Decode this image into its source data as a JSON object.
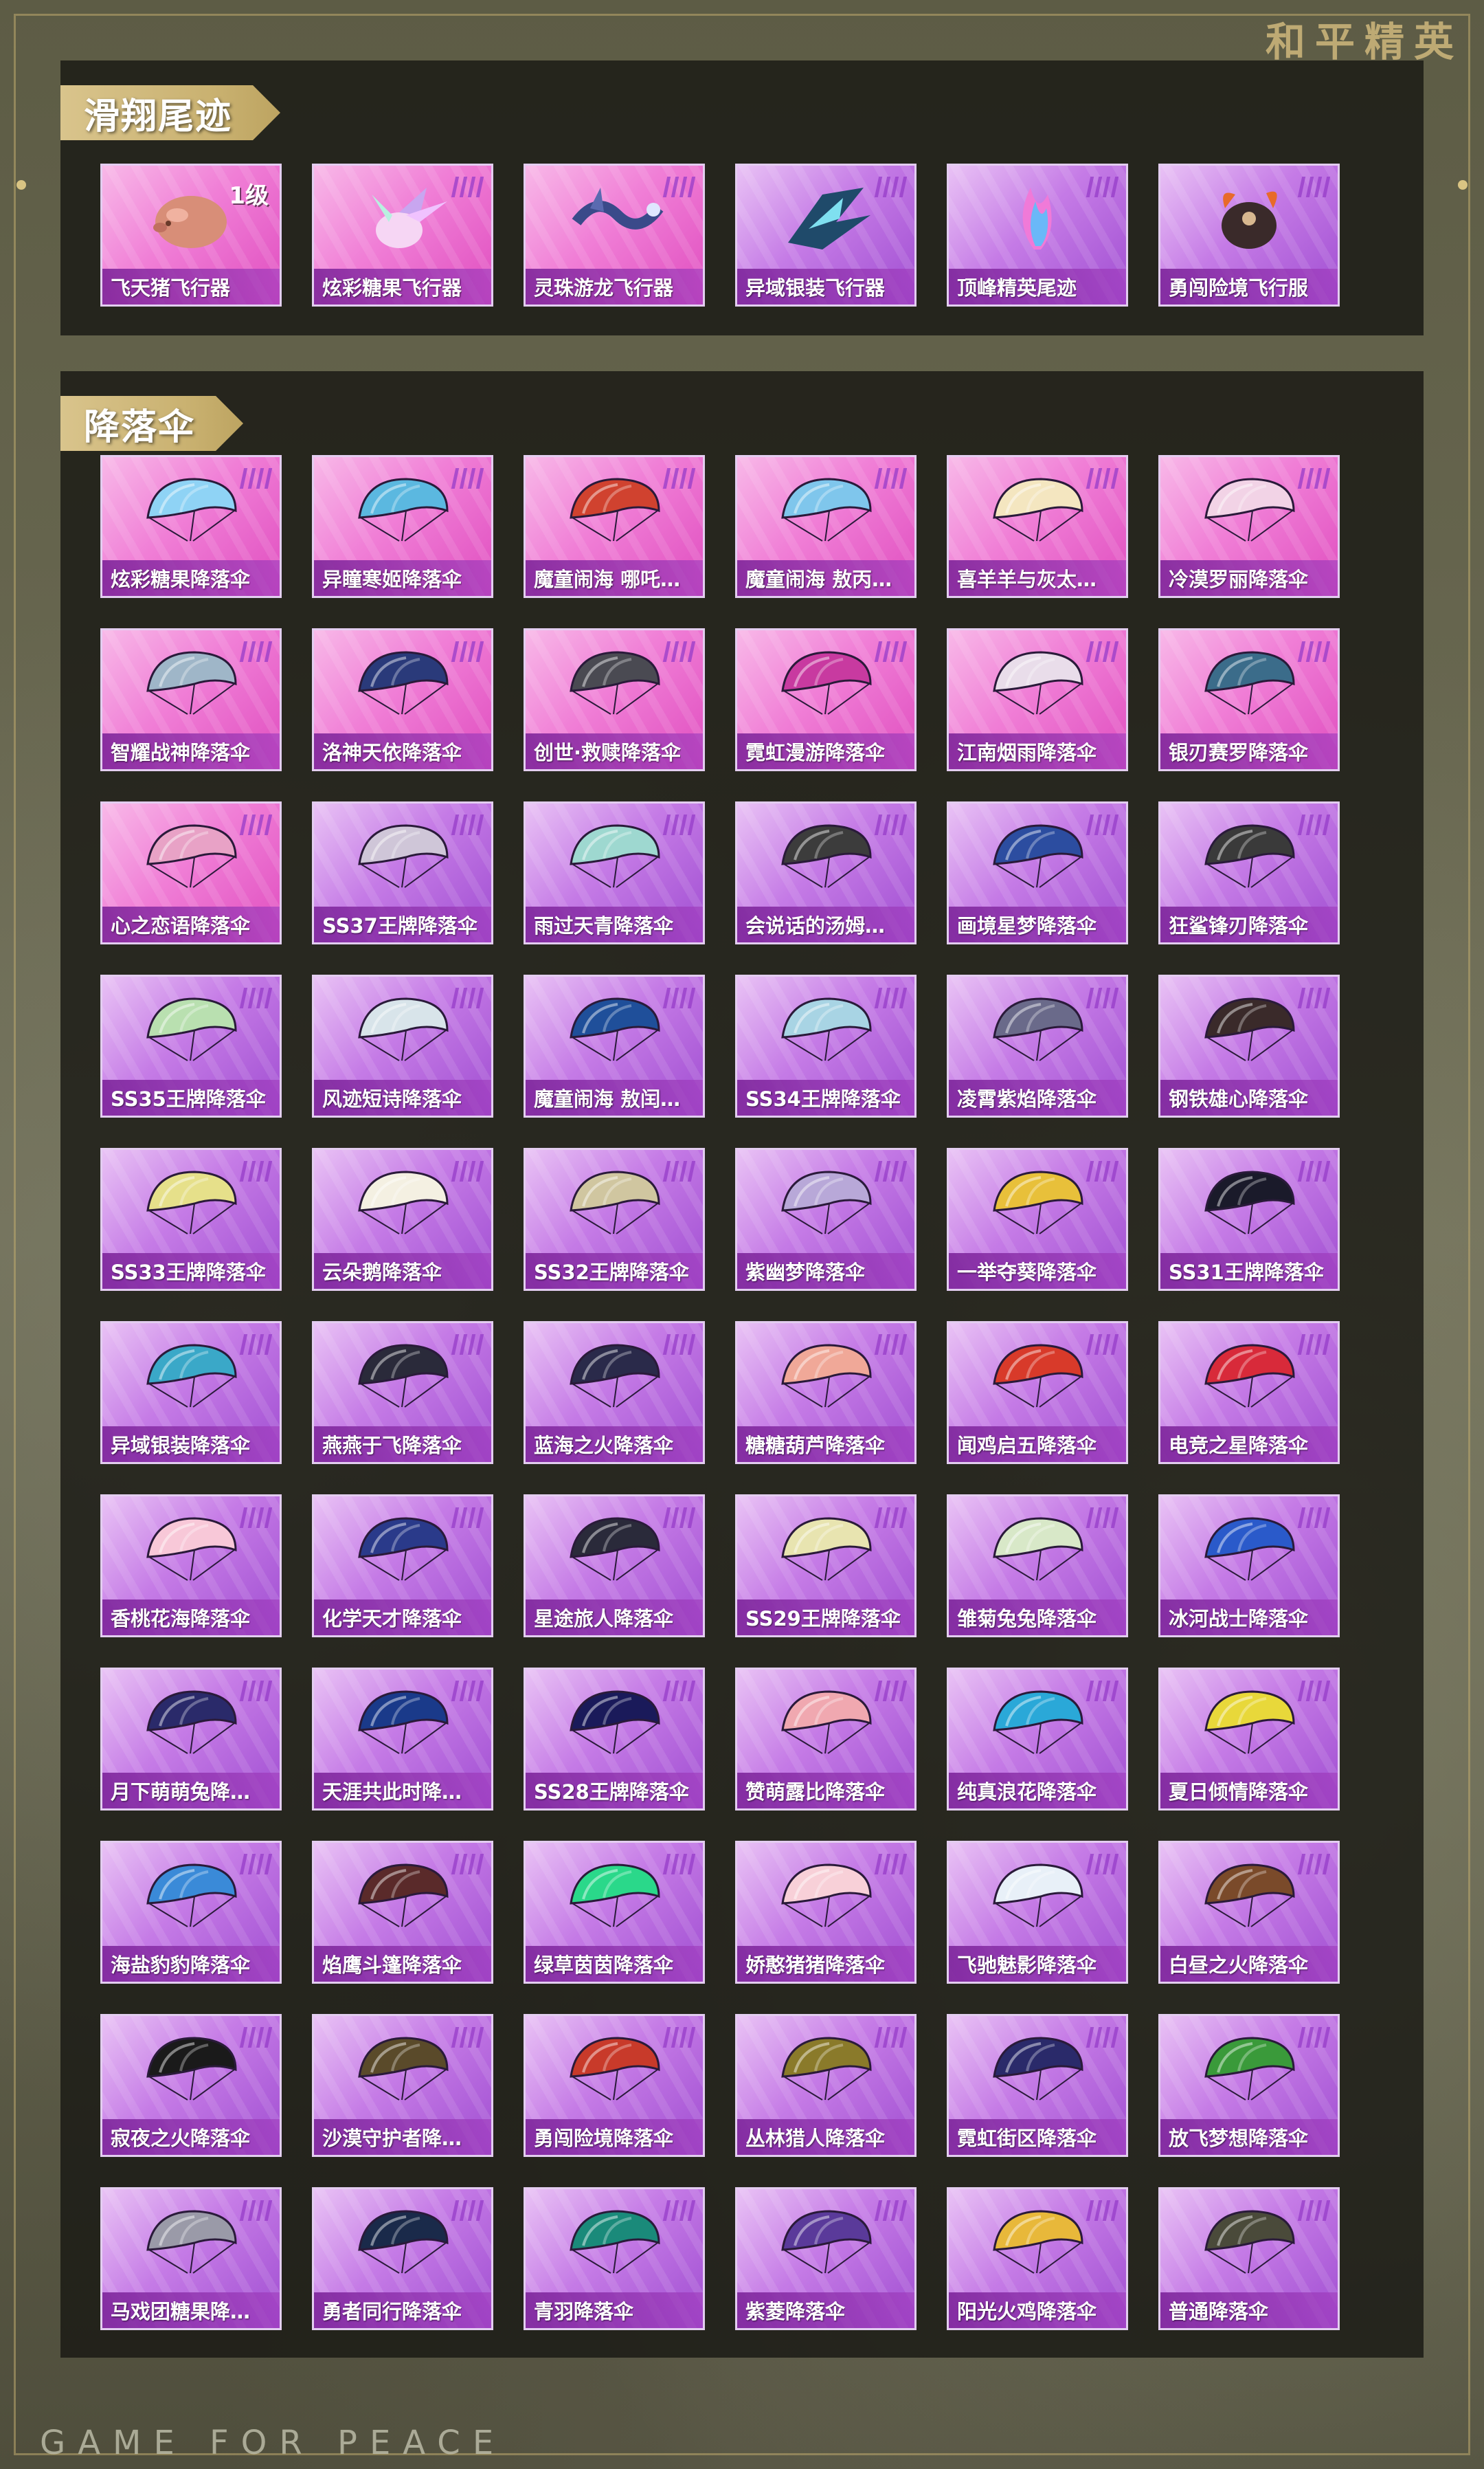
{
  "brand": {
    "top_logo": "和平精英",
    "bottom_text": "GAME FOR PEACE"
  },
  "trails": {
    "title": "滑翔尾迹",
    "items": [
      {
        "name": "飞天猪飞行器",
        "level": "1级",
        "style": "pink",
        "icon": "pig-icon"
      },
      {
        "name": "炫彩糖果飞行器",
        "style": "pink",
        "icon": "candy-craft-icon"
      },
      {
        "name": "灵珠游龙飞行器",
        "style": "pink",
        "icon": "dragon-icon"
      },
      {
        "name": "异域银装飞行器",
        "style": "purple",
        "icon": "winged-craft-icon"
      },
      {
        "name": "顶峰精英尾迹",
        "style": "purple",
        "icon": "flame-trail-icon"
      },
      {
        "name": "勇闯险境飞行服",
        "style": "purple",
        "icon": "flight-suit-icon"
      }
    ]
  },
  "chutes": {
    "title": "降落伞",
    "items": [
      {
        "name": "炫彩糖果降落伞",
        "style": "pink",
        "color": "#8fd3f5"
      },
      {
        "name": "异瞳寒姬降落伞",
        "style": "pink",
        "color": "#5bb8e0"
      },
      {
        "name": "魔童闹海 哪吒…",
        "style": "pink",
        "color": "#d0422f"
      },
      {
        "name": "魔童闹海 敖丙…",
        "style": "pink",
        "color": "#7fc6ec"
      },
      {
        "name": "喜羊羊与灰太…",
        "style": "pink",
        "color": "#f4e6c0"
      },
      {
        "name": "冷漠罗丽降落伞",
        "style": "pink",
        "color": "#f2d3e6"
      },
      {
        "name": "智耀战神降落伞",
        "style": "pink",
        "color": "#9fb6c8"
      },
      {
        "name": "洛神天依降落伞",
        "style": "pink",
        "color": "#2a3a7a"
      },
      {
        "name": "创世·救赎降落伞",
        "style": "pink",
        "color": "#4a4a52"
      },
      {
        "name": "霓虹漫游降落伞",
        "style": "pink",
        "color": "#c83aa0"
      },
      {
        "name": "江南烟雨降落伞",
        "style": "pink",
        "color": "#e9ddea"
      },
      {
        "name": "银刃赛罗降落伞",
        "style": "pink",
        "color": "#3b6c8a"
      },
      {
        "name": "心之恋语降落伞",
        "style": "pink",
        "color": "#e8a2c6"
      },
      {
        "name": "SS37王牌降落伞",
        "style": "purple",
        "color": "#cfc6d8"
      },
      {
        "name": "雨过天青降落伞",
        "style": "purple",
        "color": "#9ed8d0"
      },
      {
        "name": "会说话的汤姆…",
        "style": "purple",
        "color": "#3c3c3c"
      },
      {
        "name": "画境星梦降落伞",
        "style": "purple",
        "color": "#2c4da0"
      },
      {
        "name": "狂鲨锋刃降落伞",
        "style": "purple",
        "color": "#3a3a3a"
      },
      {
        "name": "SS35王牌降落伞",
        "style": "purple",
        "color": "#b9e0b0"
      },
      {
        "name": "风迹短诗降落伞",
        "style": "purple",
        "color": "#d8e4ea"
      },
      {
        "name": "魔童闹海 敖闰…",
        "style": "purple",
        "color": "#1f4f9a"
      },
      {
        "name": "SS34王牌降落伞",
        "style": "purple",
        "color": "#a8d4e4"
      },
      {
        "name": "凌霄紫焰降落伞",
        "style": "purple",
        "color": "#6a6a8a"
      },
      {
        "name": "钢铁雄心降落伞",
        "style": "purple",
        "color": "#3a2a2a"
      },
      {
        "name": "SS33王牌降落伞",
        "style": "purple",
        "color": "#e6e08a"
      },
      {
        "name": "云朵鹅降落伞",
        "style": "purple",
        "color": "#f4f0e2"
      },
      {
        "name": "SS32王牌降落伞",
        "style": "purple",
        "color": "#d0c6a0"
      },
      {
        "name": "紫幽梦降落伞",
        "style": "purple",
        "color": "#b8a8d8"
      },
      {
        "name": "一举夺葵降落伞",
        "style": "purple",
        "color": "#e8c03a"
      },
      {
        "name": "SS31王牌降落伞",
        "style": "purple",
        "color": "#1a1a2a"
      },
      {
        "name": "异域银装降落伞",
        "style": "purple",
        "color": "#3aa8c8"
      },
      {
        "name": "燕燕于飞降落伞",
        "style": "purple",
        "color": "#2a2a3a"
      },
      {
        "name": "蓝海之火降落伞",
        "style": "purple",
        "color": "#2a2a4a"
      },
      {
        "name": "糖糖葫芦降落伞",
        "style": "purple",
        "color": "#f0a898"
      },
      {
        "name": "闻鸡启五降落伞",
        "style": "purple",
        "color": "#d83a2a"
      },
      {
        "name": "电竞之星降落伞",
        "style": "purple",
        "color": "#d82a3a"
      },
      {
        "name": "香桃花海降落伞",
        "style": "purple",
        "color": "#f8c8d8"
      },
      {
        "name": "化学天才降落伞",
        "style": "purple",
        "color": "#2a3a8a"
      },
      {
        "name": "星途旅人降落伞",
        "style": "purple",
        "color": "#2a2a3a"
      },
      {
        "name": "SS29王牌降落伞",
        "style": "purple",
        "color": "#e8e4b0"
      },
      {
        "name": "雏菊兔兔降落伞",
        "style": "purple",
        "color": "#d8e8c8"
      },
      {
        "name": "冰河战士降落伞",
        "style": "purple",
        "color": "#2a5aca"
      },
      {
        "name": "月下萌萌兔降…",
        "style": "purple",
        "color": "#2a2a6a"
      },
      {
        "name": "天涯共此时降…",
        "style": "purple",
        "color": "#1a3a8a"
      },
      {
        "name": "SS28王牌降落伞",
        "style": "purple",
        "color": "#1a1a5a"
      },
      {
        "name": "赞萌露比降落伞",
        "style": "purple",
        "color": "#f0a8b0"
      },
      {
        "name": "纯真浪花降落伞",
        "style": "purple",
        "color": "#2aa8d8"
      },
      {
        "name": "夏日倾情降落伞",
        "style": "purple",
        "color": "#e8d83a"
      },
      {
        "name": "海盐豹豹降落伞",
        "style": "purple",
        "color": "#3a8ad8"
      },
      {
        "name": "焰鹰斗篷降落伞",
        "style": "purple",
        "color": "#5a2a2a"
      },
      {
        "name": "绿草茵茵降落伞",
        "style": "purple",
        "color": "#2ad88a"
      },
      {
        "name": "娇憨猪猪降落伞",
        "style": "purple",
        "color": "#f8d0d8"
      },
      {
        "name": "飞驰魅影降落伞",
        "style": "purple",
        "color": "#e8f0f8"
      },
      {
        "name": "白昼之火降落伞",
        "style": "purple",
        "color": "#7a4a2a"
      },
      {
        "name": "寂夜之火降落伞",
        "style": "purple",
        "color": "#1a1a1a"
      },
      {
        "name": "沙漠守护者降…",
        "style": "purple",
        "color": "#5a4a2a"
      },
      {
        "name": "勇闯险境降落伞",
        "style": "purple",
        "color": "#c83a2a"
      },
      {
        "name": "丛林猎人降落伞",
        "style": "purple",
        "color": "#8a7a2a"
      },
      {
        "name": "霓虹街区降落伞",
        "style": "purple",
        "color": "#2a2a6a"
      },
      {
        "name": "放飞梦想降落伞",
        "style": "purple",
        "color": "#3a9a3a"
      },
      {
        "name": "马戏团糖果降…",
        "style": "purple",
        "color": "#9a9aa8"
      },
      {
        "name": "勇者同行降落伞",
        "style": "purple",
        "color": "#1a2a4a"
      },
      {
        "name": "青羽降落伞",
        "style": "purple",
        "color": "#1a8a7a"
      },
      {
        "name": "紫菱降落伞",
        "style": "purple",
        "color": "#5a3a9a"
      },
      {
        "name": "阳光火鸡降落伞",
        "style": "purple",
        "color": "#e8b83a"
      },
      {
        "name": "普通降落伞",
        "style": "purple",
        "color": "#4a4a3a"
      }
    ]
  }
}
